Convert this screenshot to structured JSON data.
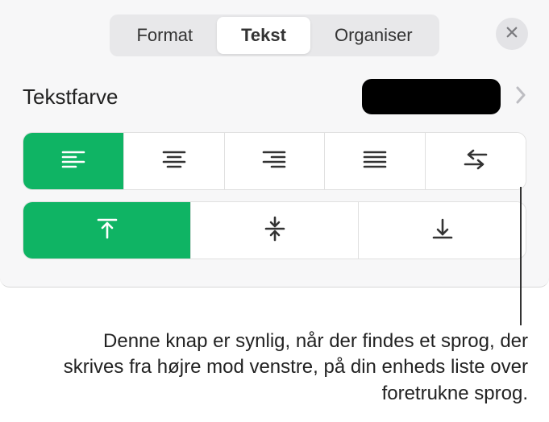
{
  "tabs": {
    "format": "Format",
    "tekst": "Tekst",
    "organiser": "Organiser"
  },
  "textcolor": {
    "label": "Tekstfarve",
    "value": "#000000"
  },
  "icons": {
    "close": "close",
    "chevron_right": "chevron-right",
    "align_left": "align-left",
    "align_center": "align-center",
    "align_right": "align-right",
    "align_justify": "align-justify",
    "rtl": "rtl-direction",
    "valign_top": "vertical-align-top",
    "valign_middle": "vertical-align-middle",
    "valign_bottom": "vertical-align-bottom"
  },
  "callout": "Denne knap er synlig, når der findes et sprog, der skrives fra højre mod venstre, på din enheds liste over foretrukne sprog."
}
